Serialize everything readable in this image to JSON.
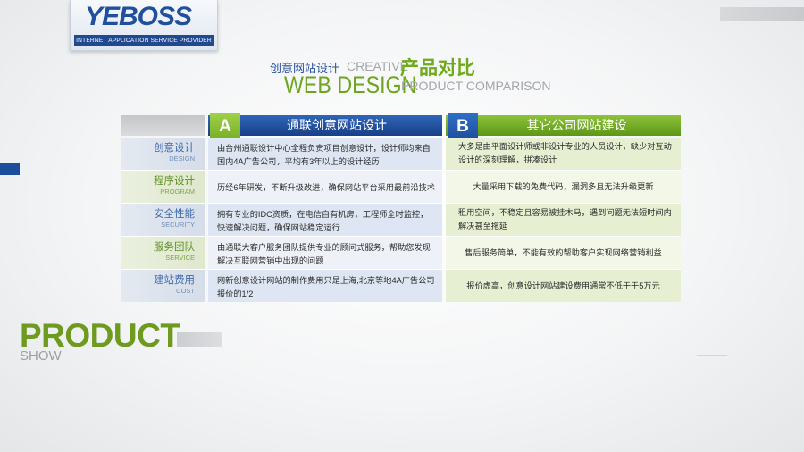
{
  "logo": {
    "brand": "YEBOSS",
    "tagline": "INTERNET APPLICATION SERVICE PROVIDER"
  },
  "heading": {
    "cn_small": "创意网站设计",
    "en_creative": "CREATIVE",
    "cn_big": "产品对比",
    "en_web_design": "WEB DESIGN",
    "en_product_comparison": "PRODUCT COMPARISON"
  },
  "table": {
    "col_a": {
      "badge": "A",
      "title": "通联创意网站设计"
    },
    "col_b": {
      "badge": "B",
      "title": "其它公司网站建设"
    },
    "rows": [
      {
        "label_cn": "创意设计",
        "label_en": "DESIGN",
        "a": "由台州通联设计中心全程负责项目创意设计，设计师均来自国内4A广告公司，平均有3年以上的设计经历",
        "b": "大多是由平面设计师或非设计专业的人员设计，缺少对互动设计的深刻理解，拼凑设计"
      },
      {
        "label_cn": "程序设计",
        "label_en": "PROGRAM",
        "a": "历经6年研发，不断升级改进，确保网站平台采用最前沿技术",
        "b": "大量采用下载的免费代码，漏洞多且无法升级更新"
      },
      {
        "label_cn": "安全性能",
        "label_en": "SECURITY",
        "a": "拥有专业的IDC资质，在电信自有机房，工程师全时监控，快速解决问题，确保网站稳定运行",
        "b": "租用空间，不稳定且容易被挂木马，遇到问题无法短时间内解决甚至拖延"
      },
      {
        "label_cn": "服务团队",
        "label_en": "SERVICE",
        "a": "由通联大客户服务团队提供专业的顾问式服务，帮助您发现解决互联网营销中出现的问题",
        "b": "售后服务简单，不能有效的帮助客户实现网络营销利益"
      },
      {
        "label_cn": "建站费用",
        "label_en": "COST",
        "a": "网新创意设计网站的制作费用只是上海,北京等地4A广告公司报价的1/2",
        "b": "报价虚高，创意设计网站建设费用通常不低于于5万元"
      }
    ]
  },
  "footer": {
    "product": "PRODUCT",
    "show": "SHOW"
  }
}
